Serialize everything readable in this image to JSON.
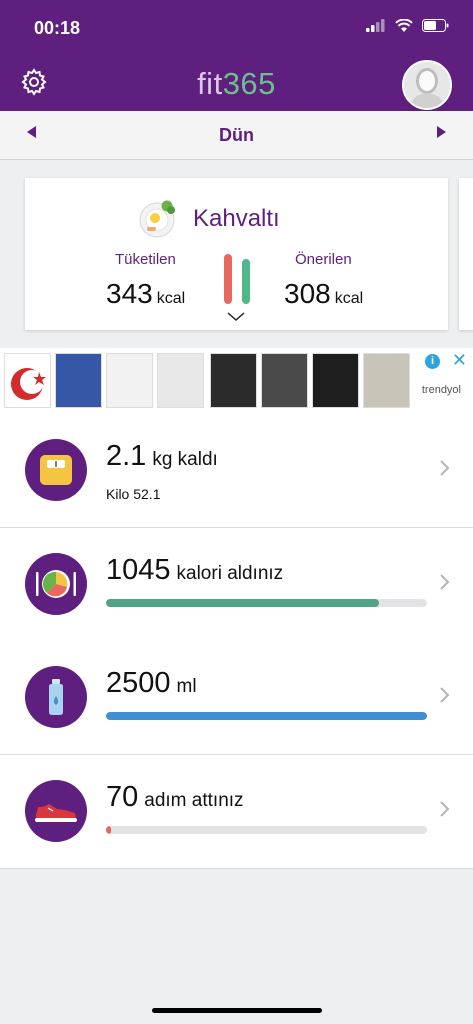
{
  "status": {
    "time": "00:18"
  },
  "app": {
    "logo_part1": "fit",
    "logo_part2": "365"
  },
  "date_nav": {
    "label": "Dün"
  },
  "meal": {
    "name": "Kahvaltı",
    "consumed_label": "Tüketilen",
    "consumed_value": "343",
    "recommended_label": "Önerilen",
    "recommended_value": "308",
    "unit": "kcal"
  },
  "ad": {
    "info": "i",
    "close": "✕",
    "brand": "trendyol"
  },
  "rows": [
    {
      "value": "2.1",
      "text": "kg kaldı",
      "sub": "Kilo 52.1"
    },
    {
      "value": "1045",
      "text": "kalori aldınız",
      "progress": 0.85
    },
    {
      "value": "2500",
      "text": "ml",
      "progress": 1.0
    },
    {
      "value": "70",
      "text": "adım attınız",
      "progress": 0.015
    }
  ],
  "colors": {
    "brand": "#5e1f7f",
    "green": "#4fa487",
    "blue": "#3f8fd3",
    "red": "#e8675f"
  }
}
